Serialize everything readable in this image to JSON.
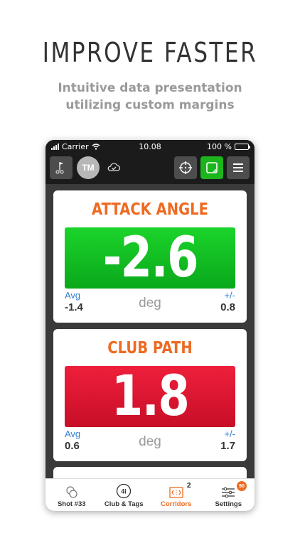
{
  "headline": "IMPROVE FASTER",
  "subheadline_line1": "Intuitive data presentation",
  "subheadline_line2": "utilizing custom margins",
  "status": {
    "carrier": "Carrier",
    "time": "10.08",
    "battery": "100 %"
  },
  "toolbar": {
    "avatar_initials": "TM"
  },
  "cards": [
    {
      "title": "ATTACK ANGLE",
      "value": "-2.6",
      "unit": "deg",
      "avg_label": "Avg",
      "avg_value": "-1.4",
      "margin_label": "+/-",
      "margin_value": "0.8",
      "color": "#12c424"
    },
    {
      "title": "CLUB PATH",
      "value": "1.8",
      "unit": "deg",
      "avg_label": "Avg",
      "avg_value": "0.6",
      "margin_label": "+/-",
      "margin_value": "1.7",
      "color": "#e3172f"
    }
  ],
  "tabs": [
    {
      "label": "Shot #33",
      "icon": "golf-balls-icon"
    },
    {
      "label": "Club & Tags",
      "icon": "club-4i-icon",
      "icon_text": "4i"
    },
    {
      "label": "Corridors",
      "icon": "corridors-icon",
      "badge": "2",
      "active": true
    },
    {
      "label": "Settings",
      "icon": "settings-sliders-icon",
      "badge": "90"
    }
  ],
  "colors": {
    "accent": "#ee6a22",
    "link": "#2f7fd1",
    "toolbar_active": "#1db51d"
  }
}
